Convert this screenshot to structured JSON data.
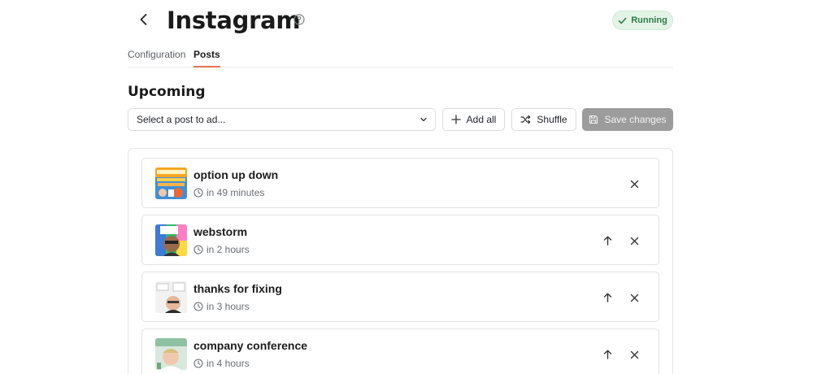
{
  "header": {
    "title": "Instagram",
    "status": "Running",
    "icons": {
      "back": "chevron-left-icon",
      "help": "help-circle-icon",
      "status": "check-icon"
    }
  },
  "tabs": [
    {
      "label": "Configuration",
      "active": false
    },
    {
      "label": "Posts",
      "active": true
    }
  ],
  "section": {
    "title": "Upcoming"
  },
  "toolbar": {
    "select_placeholder": "Select a post to ad...",
    "add_all_label": "Add all",
    "shuffle_label": "Shuffle",
    "save_label": "Save changes"
  },
  "posts": [
    {
      "title": "option up down",
      "time": "in 49 minutes",
      "can_move_up": false
    },
    {
      "title": "webstorm",
      "time": "in 2 hours",
      "can_move_up": true
    },
    {
      "title": "thanks for fixing",
      "time": "in 3 hours",
      "can_move_up": true
    },
    {
      "title": "company conference",
      "time": "in 4 hours",
      "can_move_up": true
    }
  ],
  "colors": {
    "accent_underline": "#e0735a",
    "status_bg": "#e3f4e7",
    "status_text": "#2f7a48",
    "save_button_disabled": "#9c9c9c"
  }
}
